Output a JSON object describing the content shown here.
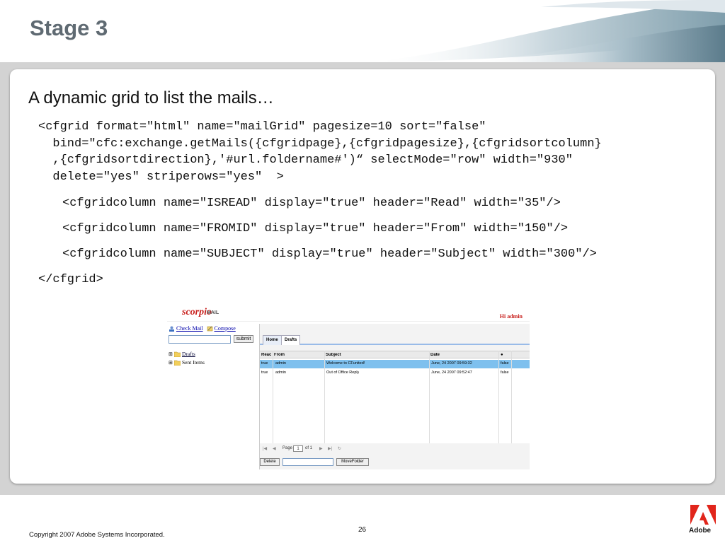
{
  "slide": {
    "title": "Stage 3",
    "heading": "A dynamic grid to list the mails…",
    "code_lines": [
      "<cfgrid format=\"html\" name=\"mailGrid\" pagesize=10 sort=\"false\"",
      "  bind=\"cfc:exchange.getMails({cfgridpage},{cfgridpagesize},{cfgridsortcolumn}",
      "  ,{cfgridsortdirection},'#url.foldername#')“ selectMode=\"row\" width=\"930\"",
      "  delete=\"yes\" striperows=\"yes\"  >",
      "<cfgridcolumn name=\"ISREAD\" display=\"true\" header=\"Read\" width=\"35\"/>",
      "<cfgridcolumn name=\"FROMID\" display=\"true\" header=\"From\" width=\"150\"/>",
      "<cfgridcolumn name=\"SUBJECT\" display=\"true\" header=\"Subject\" width=\"300\"/>",
      "</cfgrid>"
    ],
    "page_number": "26",
    "copyright": "Copyright 2007 Adobe Systems Incorporated.",
    "adobe_label": "Adobe"
  },
  "app": {
    "logo": "scorpio",
    "logo_suffix": "MAIL",
    "greeting": "Hi  admin",
    "check_mail": "Check Mail",
    "compose": "Compose",
    "submit_label": "submit",
    "folders": [
      "Drafts",
      "Sent Items"
    ],
    "tabs": [
      "Home",
      "Drafts"
    ],
    "columns": [
      "Reac",
      "From",
      "Subject",
      "Date",
      "●"
    ],
    "rows": [
      {
        "read": "true",
        "from": "admin",
        "subject": "Welcome to CFunited!",
        "date": "June, 24 2007 09:59:32",
        "flag": "false"
      },
      {
        "read": "true",
        "from": "admin",
        "subject": "Out of Office Reply",
        "date": "June, 24 2007 09:52:47",
        "flag": "false"
      }
    ],
    "pager": {
      "page_label": "Page",
      "page_value": "1",
      "of_label": "of 1"
    },
    "delete_label": "Delete",
    "move_label": "MoveFolder"
  },
  "colors": {
    "title_gray": "#5f6a72",
    "accent_red": "#c8201d",
    "selected_row": "#7ec0ee"
  }
}
